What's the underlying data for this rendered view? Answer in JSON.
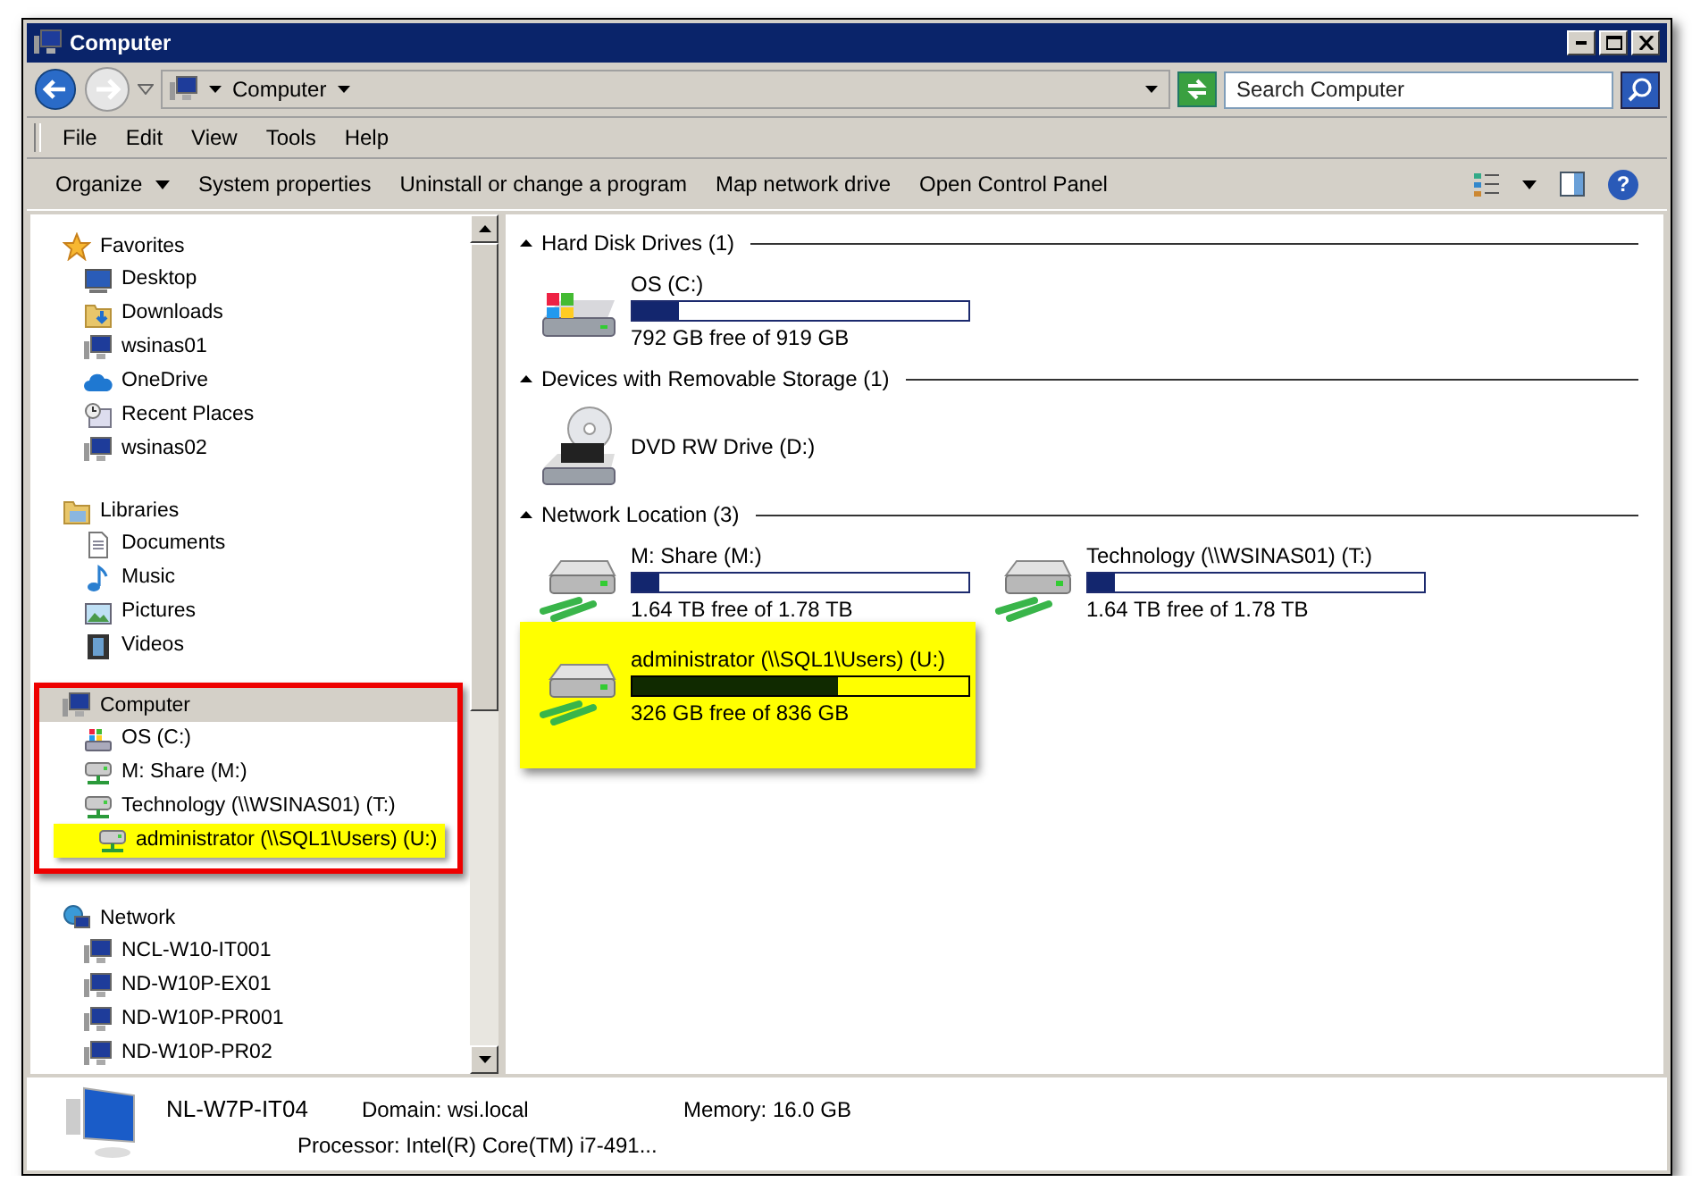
{
  "window": {
    "title": "Computer"
  },
  "address": {
    "crumbs": [
      "Computer"
    ]
  },
  "search": {
    "placeholder": "Search Computer"
  },
  "menu": [
    "File",
    "Edit",
    "View",
    "Tools",
    "Help"
  ],
  "help": {
    "label": "?"
  },
  "toolbar": [
    {
      "label": "Organize",
      "kind": "dropdown"
    },
    {
      "label": "System properties",
      "kind": "plain"
    },
    {
      "label": "Uninstall or change a program",
      "kind": "plain"
    },
    {
      "label": "Map network drive",
      "kind": "plain"
    },
    {
      "label": "Open Control Panel",
      "kind": "plain"
    }
  ],
  "sidebar": {
    "groups": [
      {
        "label": "Favorites",
        "kind": "star",
        "selected": false,
        "items": [
          {
            "label": "Desktop",
            "kind": "desktop",
            "highlighted": false
          },
          {
            "label": "Downloads",
            "kind": "downloads",
            "highlighted": false
          },
          {
            "label": "wsinas01",
            "kind": "pc",
            "highlighted": false
          },
          {
            "label": "OneDrive",
            "kind": "cloud",
            "highlighted": false
          },
          {
            "label": "Recent Places",
            "kind": "recent",
            "highlighted": false
          },
          {
            "label": "wsinas02",
            "kind": "pc",
            "highlighted": false
          }
        ]
      },
      {
        "label": "Libraries",
        "kind": "library",
        "selected": false,
        "items": [
          {
            "label": "Documents",
            "kind": "document",
            "highlighted": false
          },
          {
            "label": "Music",
            "kind": "music",
            "highlighted": false
          },
          {
            "label": "Pictures",
            "kind": "pictures",
            "highlighted": false
          },
          {
            "label": "Videos",
            "kind": "videos",
            "highlighted": false
          }
        ]
      },
      {
        "label": "Computer",
        "kind": "pc",
        "selected": true,
        "outlined": true,
        "items": [
          {
            "label": "OS (C:)",
            "kind": "windrive",
            "highlighted": false
          },
          {
            "label": "M: Share (M:)",
            "kind": "netdrive",
            "highlighted": false
          },
          {
            "label": "Technology (\\\\WSINAS01) (T:)",
            "kind": "netdrive",
            "highlighted": false
          },
          {
            "label": "administrator (\\\\SQL1\\Users) (U:)",
            "kind": "netdrive",
            "highlighted": true
          }
        ]
      },
      {
        "label": "Network",
        "kind": "network",
        "selected": false,
        "items": [
          {
            "label": "NCL-W10-IT001",
            "kind": "pc",
            "highlighted": false
          },
          {
            "label": "ND-W10P-EX01",
            "kind": "pc",
            "highlighted": false
          },
          {
            "label": "ND-W10P-PR001",
            "kind": "pc",
            "highlighted": false
          },
          {
            "label": "ND-W10P-PR02",
            "kind": "pc",
            "highlighted": false
          }
        ]
      }
    ]
  },
  "sections": [
    {
      "title": "Hard Disk Drives (1)",
      "expanded": true,
      "drives": [
        {
          "name": "OS (C:)",
          "kind": "windrive",
          "level": 0.14,
          "free": "792 GB free of 919 GB",
          "highlighted": false
        }
      ]
    },
    {
      "title": "Devices with Removable Storage (1)",
      "expanded": true,
      "drives": [
        {
          "name": "DVD RW Drive (D:)",
          "kind": "dvd",
          "highlighted": false
        }
      ]
    },
    {
      "title": "Network Location (3)",
      "expanded": true,
      "drives": [
        {
          "name": "M: Share (M:)",
          "kind": "netdrive",
          "level": 0.08,
          "free": "1.64 TB free of 1.78 TB",
          "highlighted": false
        },
        {
          "name": "Technology (\\\\WSINAS01) (T:)",
          "kind": "netdrive",
          "level": 0.08,
          "free": "1.64 TB free of 1.78 TB",
          "highlighted": false
        },
        {
          "name": "administrator (\\\\SQL1\\Users) (U:)",
          "kind": "netdrive",
          "level": 0.61,
          "free": "326 GB free of 836 GB",
          "highlighted": true
        }
      ]
    }
  ],
  "details": {
    "computer_name": "NL-W7P-IT04",
    "domain": "Domain: wsi.local",
    "memory": "Memory: 16.0 GB",
    "processor": "Processor: Intel(R) Core(TM) i7-491..."
  }
}
